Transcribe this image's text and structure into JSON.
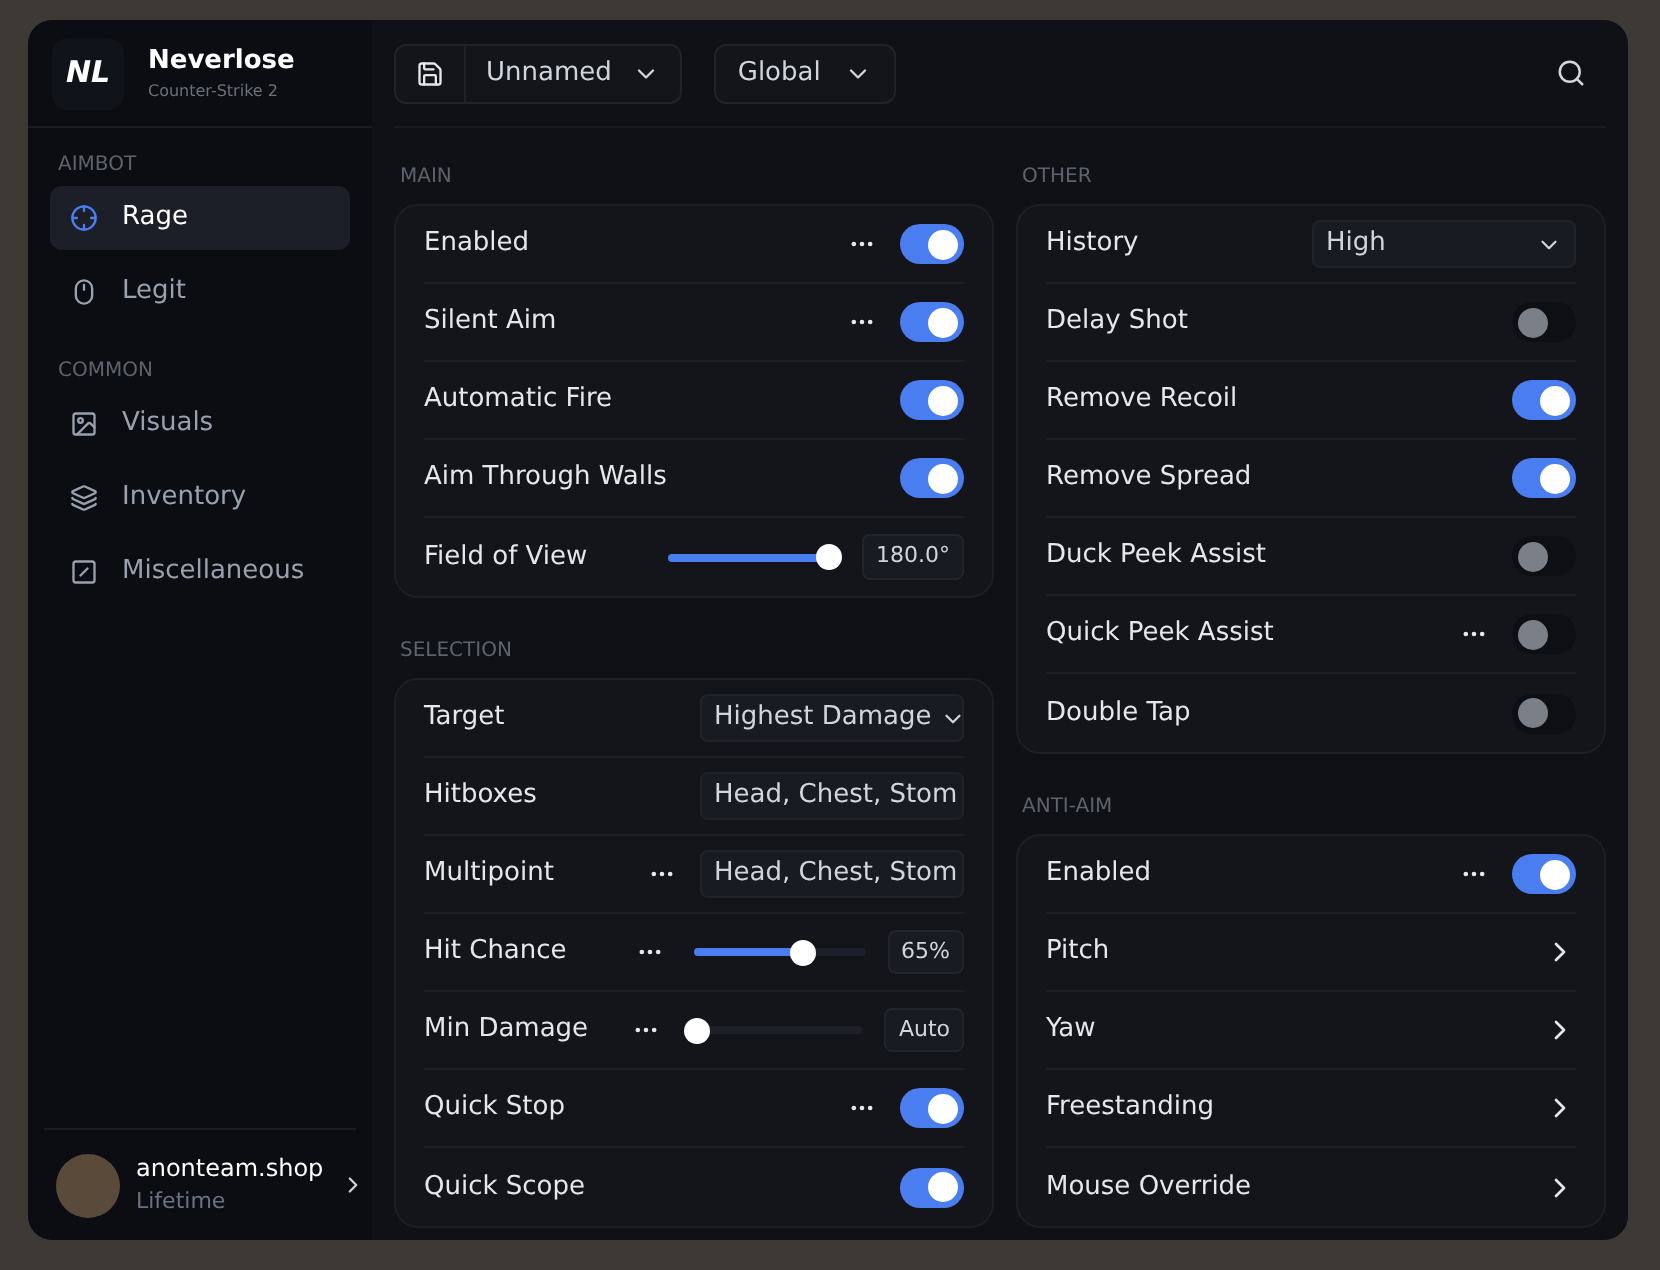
{
  "sidebar": {
    "logo": "NL",
    "title": "Neverlose",
    "subtitle": "Counter-Strike 2",
    "sections": [
      {
        "heading": "AIMBOT",
        "items": [
          {
            "label": "Rage",
            "selected": true
          },
          {
            "label": "Legit",
            "selected": false
          }
        ]
      },
      {
        "heading": "COMMON",
        "items": [
          {
            "label": "Visuals",
            "selected": false
          },
          {
            "label": "Inventory",
            "selected": false
          },
          {
            "label": "Miscellaneous",
            "selected": false
          }
        ]
      }
    ],
    "user": {
      "name": "anonteam.shop",
      "plan": "Lifetime"
    }
  },
  "toolbar": {
    "config": "Unnamed",
    "scope": "Global"
  },
  "columns": [
    [
      {
        "heading": "MAIN",
        "rows": [
          {
            "kind": "toggle",
            "label": "Enabled",
            "options": true,
            "on": true
          },
          {
            "kind": "toggle",
            "label": "Silent Aim",
            "options": true,
            "on": true
          },
          {
            "kind": "toggle",
            "label": "Automatic Fire",
            "options": false,
            "on": true
          },
          {
            "kind": "toggle",
            "label": "Aim Through Walls",
            "options": false,
            "on": true
          },
          {
            "kind": "slider",
            "label": "Field of View",
            "options": false,
            "level": 0.98,
            "reading": "180.0°"
          }
        ]
      },
      {
        "heading": "SELECTION",
        "rows": [
          {
            "kind": "dropdown",
            "label": "Target",
            "options": false,
            "value": "Highest Damage"
          },
          {
            "kind": "dropdown",
            "label": "Hitboxes",
            "options": false,
            "value": "Head, Chest, Stom"
          },
          {
            "kind": "dropdown",
            "label": "Multipoint",
            "options": true,
            "value": "Head, Chest, Stom"
          },
          {
            "kind": "slider",
            "label": "Hit Chance",
            "options": true,
            "level": 0.65,
            "reading": "65%"
          },
          {
            "kind": "slider",
            "label": "Min Damage",
            "options": true,
            "level": 0,
            "reading": "Auto"
          },
          {
            "kind": "toggle",
            "label": "Quick Stop",
            "options": true,
            "on": true
          },
          {
            "kind": "toggle",
            "label": "Quick Scope",
            "options": false,
            "on": true
          }
        ]
      }
    ],
    [
      {
        "heading": "OTHER",
        "rows": [
          {
            "kind": "dropdown",
            "label": "History",
            "options": false,
            "value": "High"
          },
          {
            "kind": "toggle",
            "label": "Delay Shot",
            "options": false,
            "on": false
          },
          {
            "kind": "toggle",
            "label": "Remove Recoil",
            "options": false,
            "on": true
          },
          {
            "kind": "toggle",
            "label": "Remove Spread",
            "options": false,
            "on": true
          },
          {
            "kind": "toggle",
            "label": "Duck Peek Assist",
            "options": false,
            "on": false
          },
          {
            "kind": "toggle",
            "label": "Quick Peek Assist",
            "options": true,
            "on": false
          },
          {
            "kind": "toggle",
            "label": "Double Tap",
            "options": false,
            "on": false
          }
        ]
      },
      {
        "heading": "ANTI-AIM",
        "rows": [
          {
            "kind": "toggle",
            "label": "Enabled",
            "options": true,
            "on": true
          },
          {
            "kind": "link",
            "label": "Pitch",
            "options": false
          },
          {
            "kind": "link",
            "label": "Yaw",
            "options": false
          },
          {
            "kind": "link",
            "label": "Freestanding",
            "options": false
          },
          {
            "kind": "link",
            "label": "Mouse Override",
            "options": false
          }
        ]
      }
    ]
  ]
}
